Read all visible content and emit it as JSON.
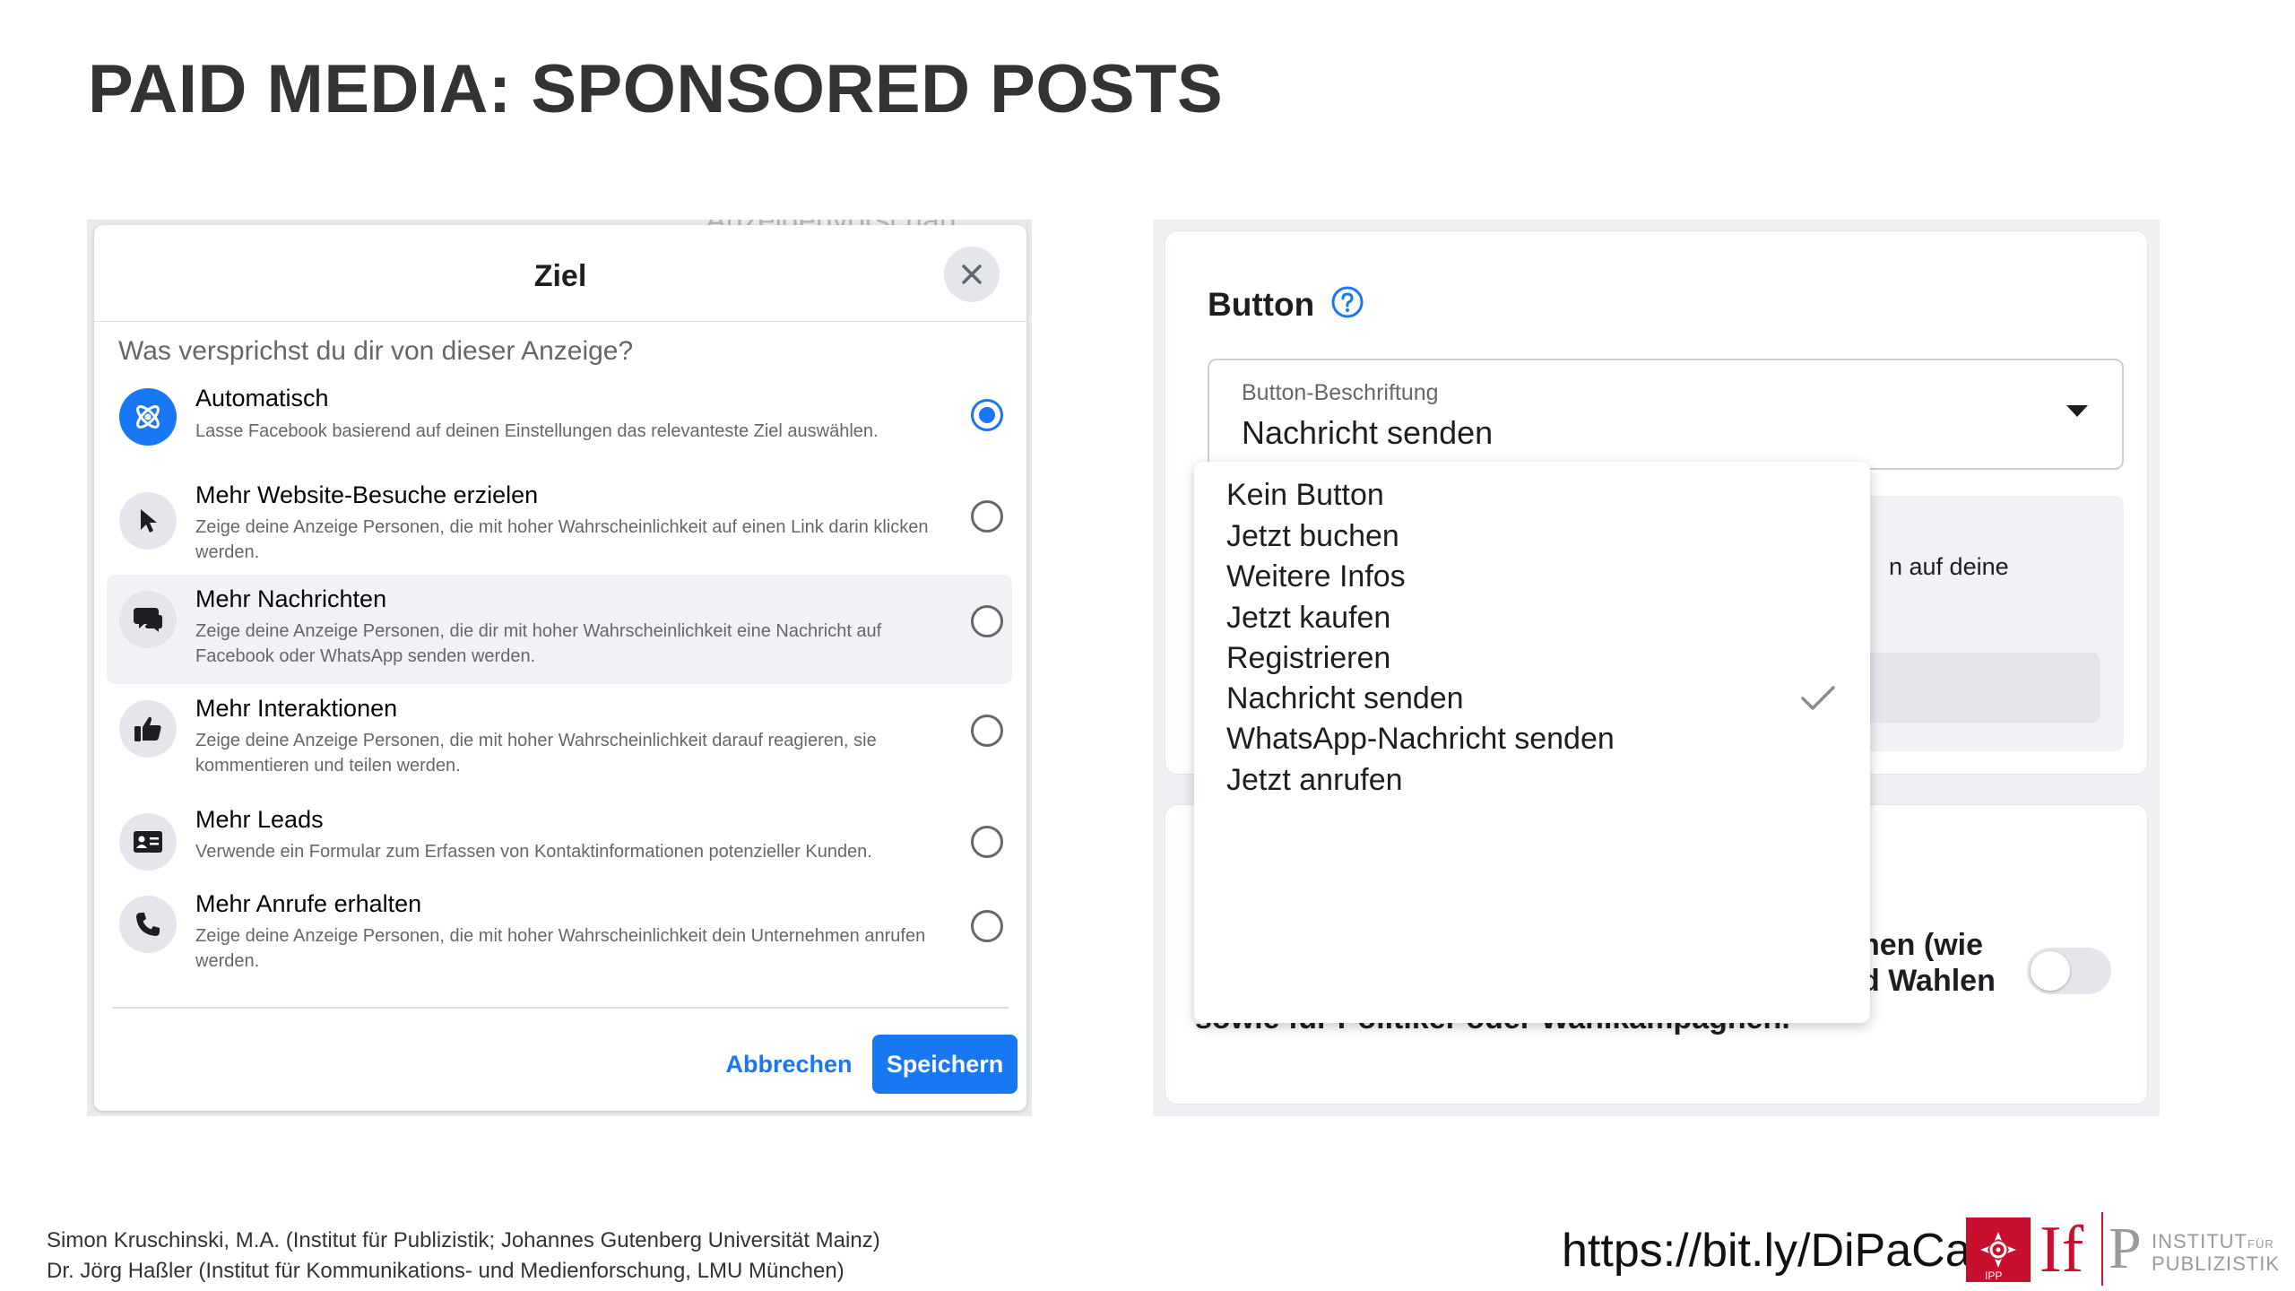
{
  "slide": {
    "title": "PAID MEDIA: SPONSORED POSTS"
  },
  "left_panel": {
    "peek_text": "Anzeigenvorschau",
    "dialog": {
      "title": "Ziel",
      "question": "Was versprichst du dir von dieser Anzeige?",
      "options": [
        {
          "title": "Automatisch",
          "description": "Lasse Facebook basierend auf deinen Einstellungen das relevanteste Ziel auswählen.",
          "icon": "atom-icon",
          "selected": true
        },
        {
          "title": "Mehr Website-Besuche erzielen",
          "description": "Zeige deine Anzeige Personen, die mit hoher Wahrscheinlichkeit auf einen Link darin klicken werden.",
          "icon": "cursor-icon",
          "selected": false
        },
        {
          "title": "Mehr Nachrichten",
          "description": "Zeige deine Anzeige Personen, die dir mit hoher Wahrscheinlichkeit eine Nachricht auf Facebook oder WhatsApp senden werden.",
          "icon": "chat-icon",
          "selected": false,
          "highlighted": true
        },
        {
          "title": "Mehr Interaktionen",
          "description": "Zeige deine Anzeige Personen, die mit hoher Wahrscheinlichkeit darauf reagieren, sie kommentieren und teilen werden.",
          "icon": "thumbs-up-icon",
          "selected": false
        },
        {
          "title": "Mehr Leads",
          "description": "Verwende ein Formular zum Erfassen von Kontaktinformationen potenzieller Kunden.",
          "icon": "contact-card-icon",
          "selected": false
        },
        {
          "title": "Mehr Anrufe erhalten",
          "description": "Zeige deine Anzeige Personen, die mit hoher Wahrscheinlichkeit dein Unternehmen anrufen werden.",
          "icon": "phone-icon",
          "selected": false
        }
      ],
      "cancel_label": "Abbrechen",
      "save_label": "Speichern"
    }
  },
  "right_panel": {
    "section_title": "Button",
    "select": {
      "label": "Button-Beschriftung",
      "value": "Nachricht senden"
    },
    "dropdown_options": [
      {
        "label": "Kein Button",
        "checked": false
      },
      {
        "label": "Jetzt buchen",
        "checked": false
      },
      {
        "label": "Weitere Infos",
        "checked": false
      },
      {
        "label": "Jetzt kaufen",
        "checked": false
      },
      {
        "label": "Registrieren",
        "checked": false
      },
      {
        "label": "Nachricht senden",
        "checked": true
      },
      {
        "label": "WhatsApp-Nachricht senden",
        "checked": false
      },
      {
        "label": "Jetzt anrufen",
        "checked": false
      }
    ],
    "partial_text_upper": "n auf deine",
    "partial_text_lower_1": "nen (wie",
    "partial_text_lower_2": "d Wahlen",
    "partial_text_lower_3": "sowie für Politiker oder Wahlkampagnen.",
    "toggle_on": false
  },
  "footer": {
    "credit_line_1": "Simon Kruschinski, M.A. (Institut für Publizistik; Johannes Gutenberg Universität Mainz)",
    "credit_line_2": "Dr. Jörg Haßler (Institut für Kommunikations- und Medienforschung, LMU München)",
    "url": "https://bit.ly/DiPaCa",
    "logo": {
      "ipp_label": "IPP",
      "if_mark": "If",
      "p_mark": "P",
      "inst_line_1": "INSTITUT",
      "inst_fuer": "FÜR",
      "inst_line_2": "PUBLIZISTIK"
    }
  },
  "colors": {
    "accent": "#1877f2",
    "logo_red": "#c8102e",
    "title": "#333333"
  }
}
